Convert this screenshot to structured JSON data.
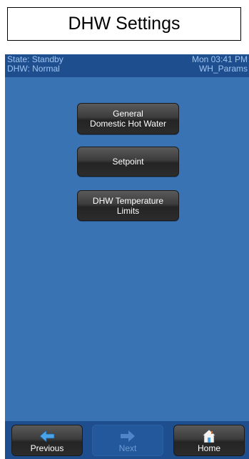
{
  "header": {
    "title": "DHW Settings"
  },
  "status": {
    "state": "State: Standby",
    "dhw": "DHW: Normal",
    "time": "Mon 03:41 PM",
    "screen": "WH_Params"
  },
  "menu": {
    "items": [
      {
        "line1": "General",
        "line2": "Domestic Hot Water"
      },
      {
        "line1": "Setpoint",
        "line2": ""
      },
      {
        "line1": "DHW Temperature",
        "line2": "Limits"
      }
    ]
  },
  "nav": {
    "previous": "Previous",
    "next": "Next",
    "home": "Home"
  },
  "colors": {
    "screen_bg": "#3a73b4",
    "bar_bg": "#1f4e8f",
    "status_text": "#9fc4ef",
    "arrow_blue": "#4aa3e6"
  },
  "icons": {
    "previous": "arrow-left-icon",
    "next": "arrow-right-icon",
    "home": "home-icon"
  }
}
